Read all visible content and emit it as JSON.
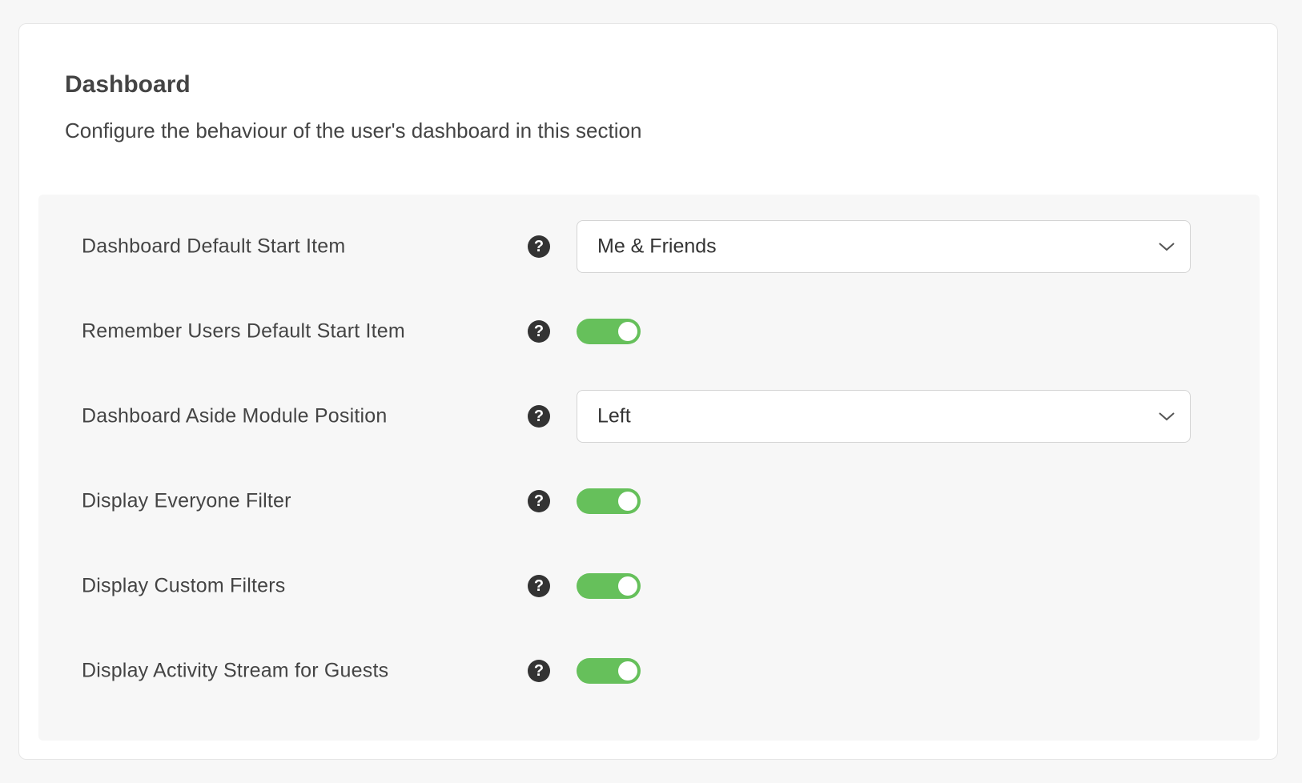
{
  "section": {
    "title": "Dashboard",
    "description": "Configure the behaviour of the user's dashboard in this section"
  },
  "settings": [
    {
      "label": "Dashboard Default Start Item",
      "control": "select",
      "value": "Me & Friends"
    },
    {
      "label": "Remember Users Default Start Item",
      "control": "toggle",
      "value": "on"
    },
    {
      "label": "Dashboard Aside Module Position",
      "control": "select",
      "value": "Left"
    },
    {
      "label": "Display Everyone Filter",
      "control": "toggle",
      "value": "on"
    },
    {
      "label": "Display Custom Filters",
      "control": "toggle",
      "value": "on"
    },
    {
      "label": "Display Activity Stream for Guests",
      "control": "toggle",
      "value": "on"
    }
  ],
  "icons": {
    "help": "question-circle-icon",
    "dropdown": "chevron-down-icon"
  },
  "help_glyph": "?",
  "colors": {
    "toggle_on": "#66c05b",
    "help_icon": "#333333",
    "panel_bg": "#f7f7f7"
  }
}
